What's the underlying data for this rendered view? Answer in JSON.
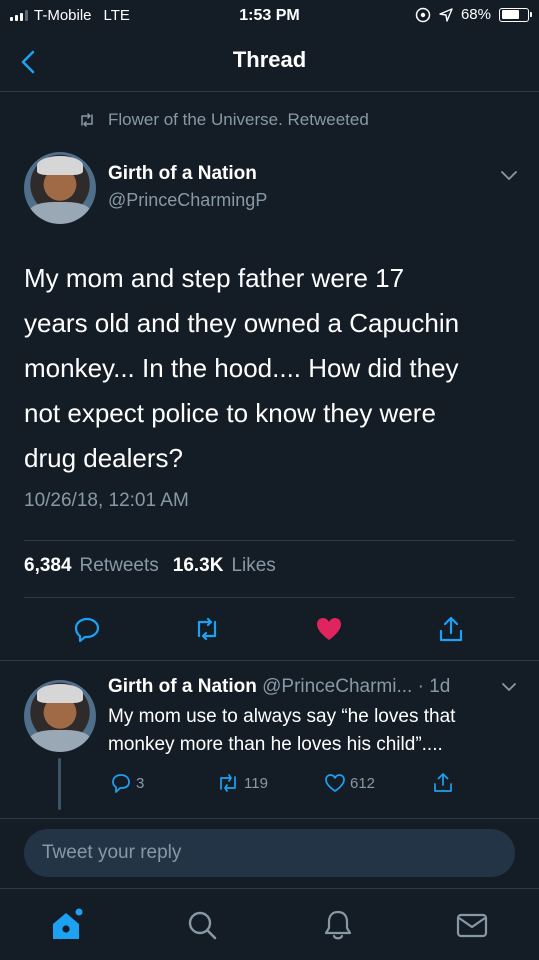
{
  "status_bar": {
    "carrier": "T-Mobile",
    "network": "LTE",
    "time": "1:53 PM",
    "battery": "68%",
    "battery_level": 0.68
  },
  "header": {
    "title": "Thread"
  },
  "retweet_context": "Flower of the Universe. Retweeted",
  "main_tweet": {
    "author_name": "Girth of a Nation",
    "author_handle": "@PrinceCharmingP",
    "lines": [
      "My mom and step father were 17",
      "years old and they owned a Capuchin",
      "monkey... In the hood.... How did they",
      "not expect police to know they were",
      "drug dealers?"
    ],
    "timestamp": "10/26/18, 12:01 AM",
    "retweets_count": "6,384",
    "retweets_label": "Retweets",
    "likes_count": "16.3K",
    "likes_label": "Likes",
    "liked": true
  },
  "reply_tweet": {
    "author_name": "Girth of a Nation",
    "author_handle": "@PrinceCharmi...",
    "separator": "·",
    "age": "1d",
    "line1": "My mom use to always say “he loves that",
    "line2": "monkey more than he loves his child”....",
    "replies": "3",
    "retweets": "119",
    "likes": "612"
  },
  "compose": {
    "placeholder": "Tweet your reply"
  },
  "tabs": [
    "home-icon",
    "search-icon",
    "notifications-icon",
    "messages-icon"
  ],
  "colors": {
    "background": "#141d26",
    "accent": "#1da1f2",
    "muted": "#8899a6",
    "like": "#e0245e"
  }
}
